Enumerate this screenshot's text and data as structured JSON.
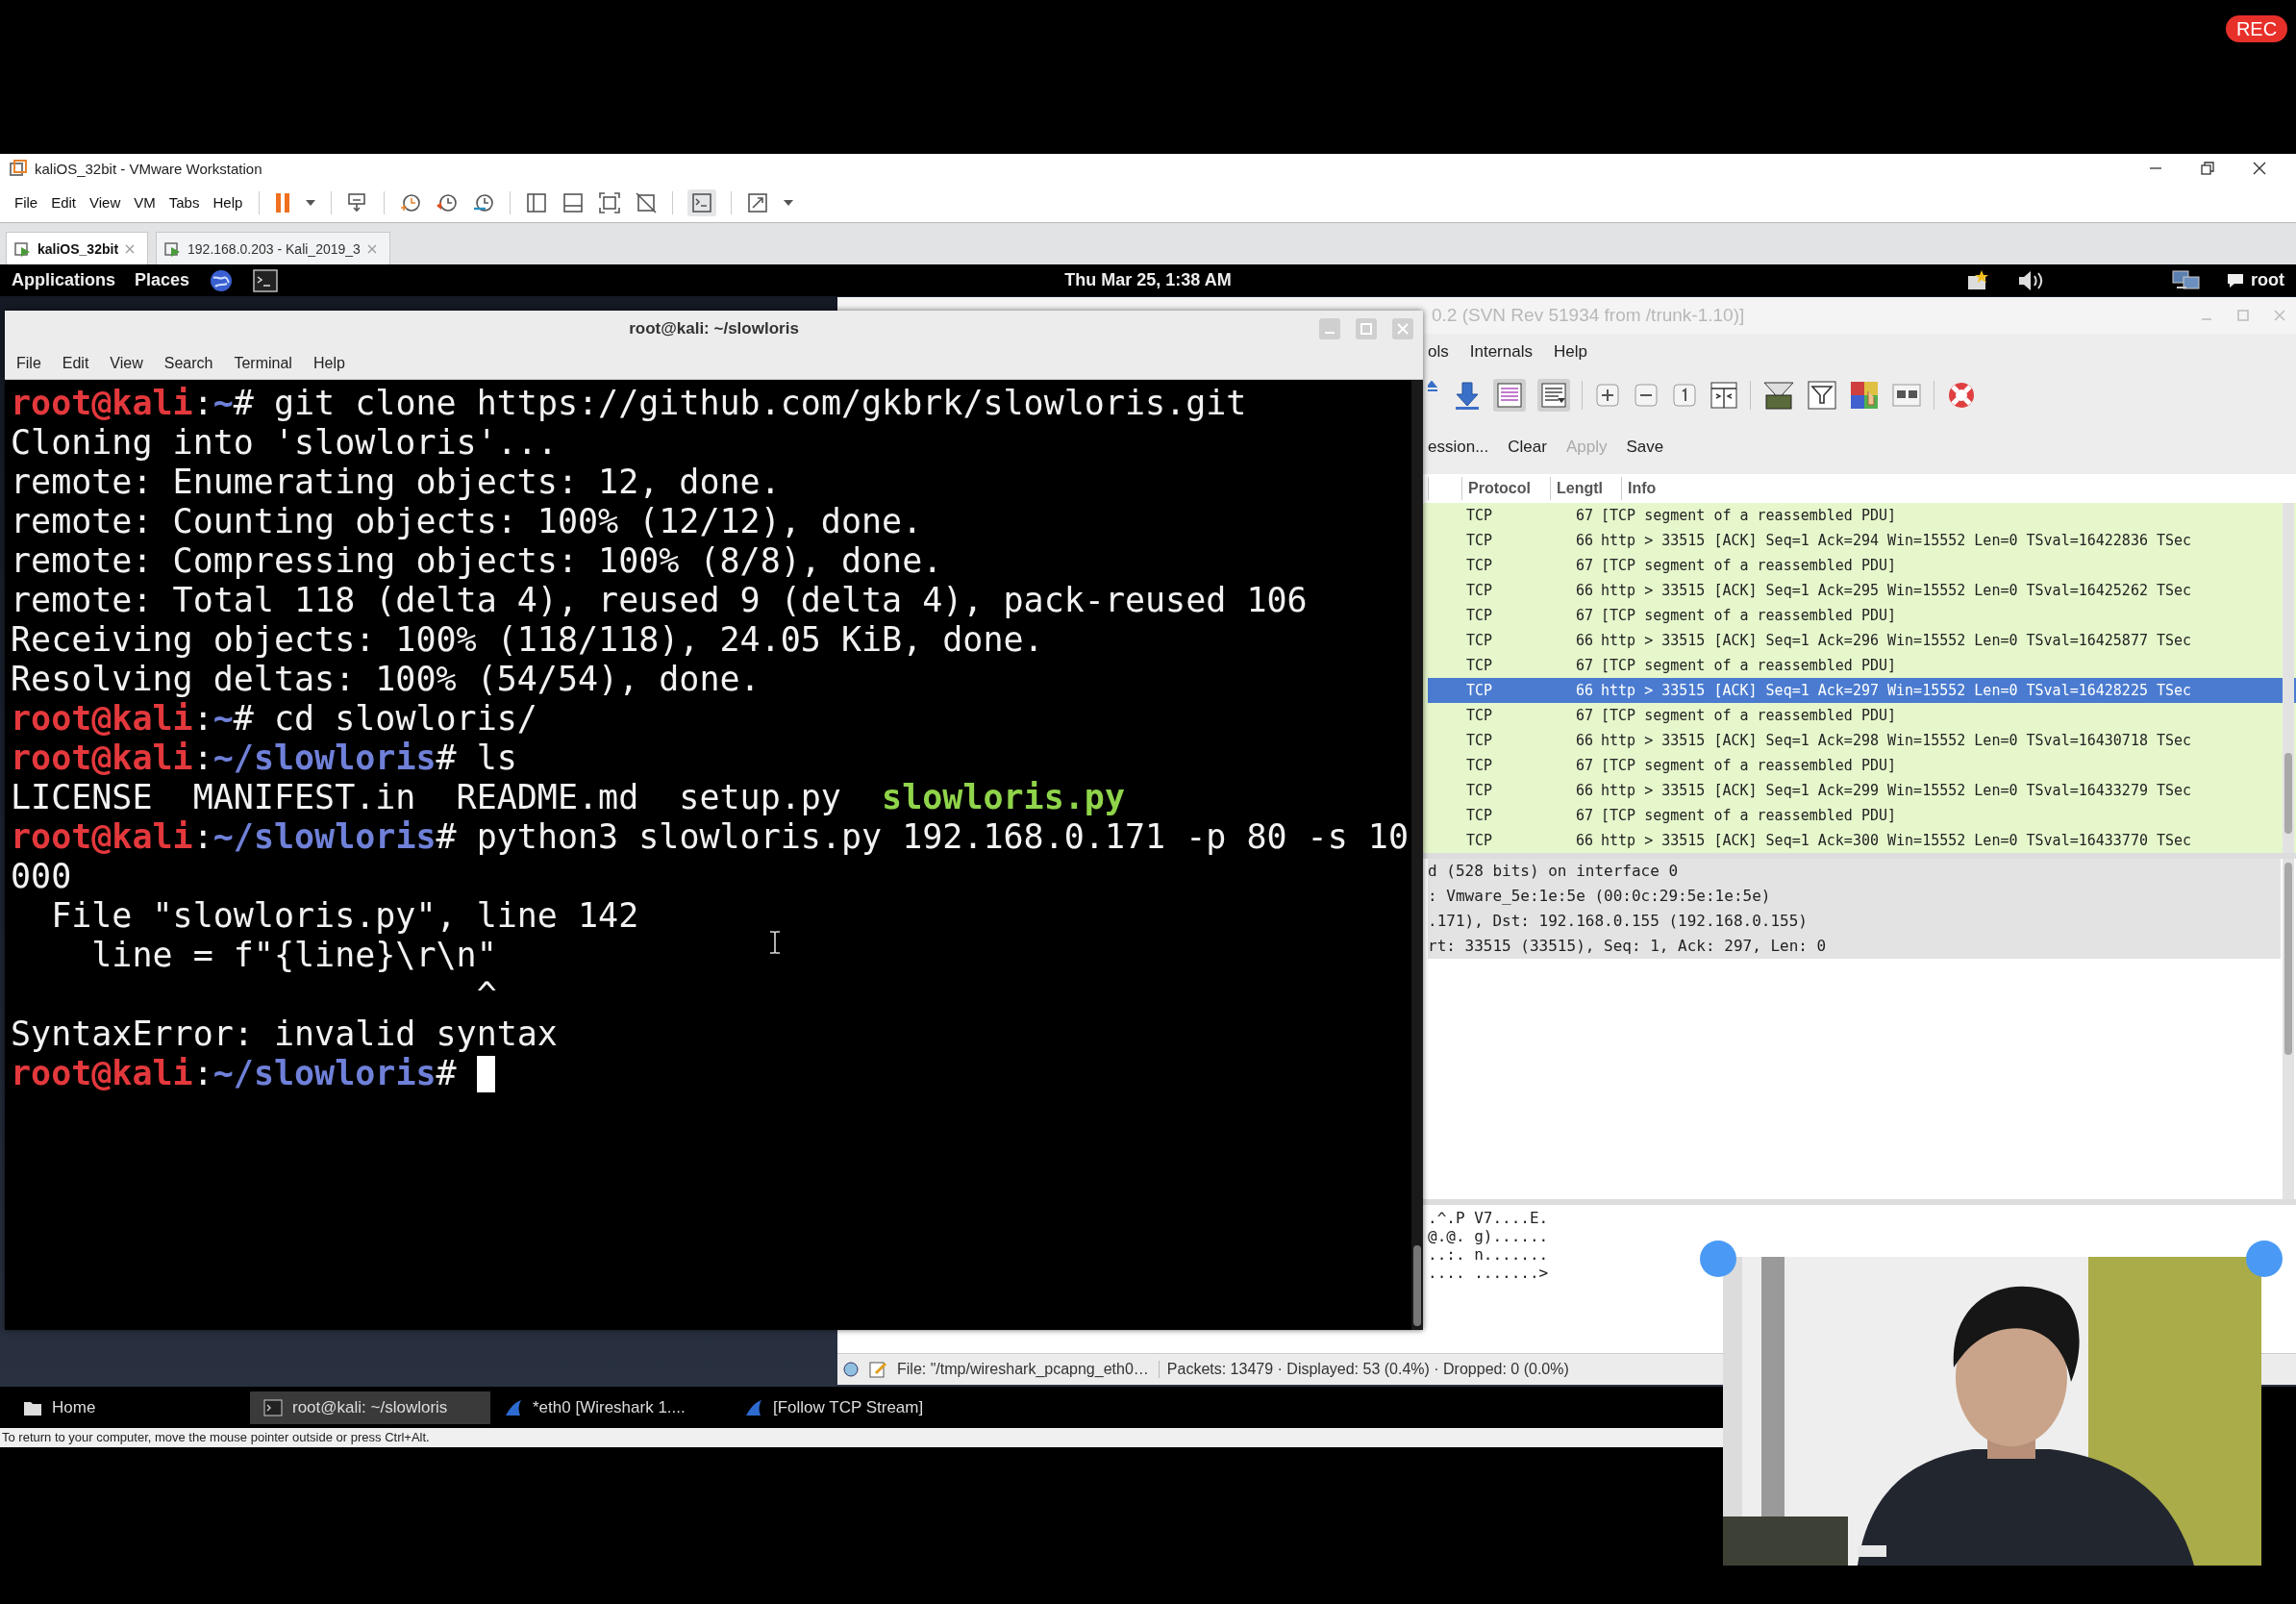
{
  "rec_badge": "REC",
  "vmware": {
    "title": "kaliOS_32bit - VMware Workstation",
    "menu": [
      "File",
      "Edit",
      "View",
      "VM",
      "Tabs",
      "Help"
    ],
    "tabs": [
      {
        "label": "kaliOS_32bit",
        "selected": true
      },
      {
        "label": "192.168.0.203 - Kali_2019_3",
        "selected": false
      }
    ],
    "status_hint": "To return to your computer, move the mouse pointer outside or press Ctrl+Alt."
  },
  "kali_panel": {
    "menus": [
      "Applications",
      "Places"
    ],
    "clock": "Thu Mar 25, 1:38 AM",
    "user": "root"
  },
  "terminal": {
    "title": "root@kali: ~/slowloris",
    "menu": [
      "File",
      "Edit",
      "View",
      "Search",
      "Terminal",
      "Help"
    ],
    "cursor": true,
    "lines": [
      {
        "kind": "text",
        "segments": [
          {
            "kind": "user",
            "text": "root@kali"
          },
          {
            "kind": "plain",
            "text": ":"
          },
          {
            "kind": "path",
            "text": "~"
          },
          {
            "kind": "plain",
            "text": "# git clone https://github.com/gkbrk/slowloris.git"
          }
        ]
      },
      {
        "kind": "text",
        "segments": [
          {
            "kind": "plain",
            "text": "Cloning into 'slowloris'..."
          }
        ]
      },
      {
        "kind": "text",
        "segments": [
          {
            "kind": "plain",
            "text": "remote: Enumerating objects: 12, done."
          }
        ]
      },
      {
        "kind": "text",
        "segments": [
          {
            "kind": "plain",
            "text": "remote: Counting objects: 100% (12/12), done."
          }
        ]
      },
      {
        "kind": "text",
        "segments": [
          {
            "kind": "plain",
            "text": "remote: Compressing objects: 100% (8/8), done."
          }
        ]
      },
      {
        "kind": "text",
        "segments": [
          {
            "kind": "plain",
            "text": "remote: Total 118 (delta 4), reused 9 (delta 4), pack-reused 106"
          }
        ]
      },
      {
        "kind": "text",
        "segments": [
          {
            "kind": "plain",
            "text": "Receiving objects: 100% (118/118), 24.05 KiB, done."
          }
        ]
      },
      {
        "kind": "text",
        "segments": [
          {
            "kind": "plain",
            "text": "Resolving deltas: 100% (54/54), done."
          }
        ]
      },
      {
        "kind": "text",
        "segments": [
          {
            "kind": "user",
            "text": "root@kali"
          },
          {
            "kind": "plain",
            "text": ":"
          },
          {
            "kind": "path",
            "text": "~"
          },
          {
            "kind": "plain",
            "text": "# cd slowloris/"
          }
        ]
      },
      {
        "kind": "text",
        "segments": [
          {
            "kind": "user",
            "text": "root@kali"
          },
          {
            "kind": "plain",
            "text": ":"
          },
          {
            "kind": "path",
            "text": "~/slowloris"
          },
          {
            "kind": "plain",
            "text": "# ls"
          }
        ]
      },
      {
        "kind": "text",
        "segments": [
          {
            "kind": "plain",
            "text": "LICENSE  MANIFEST.in  README.md  setup.py  "
          },
          {
            "kind": "exec",
            "text": "slowloris.py"
          }
        ]
      },
      {
        "kind": "text",
        "segments": [
          {
            "kind": "user",
            "text": "root@kali"
          },
          {
            "kind": "plain",
            "text": ":"
          },
          {
            "kind": "path",
            "text": "~/slowloris"
          },
          {
            "kind": "plain",
            "text": "# python3 slowloris.py 192.168.0.171 -p 80 -s 10"
          }
        ]
      },
      {
        "kind": "text",
        "segments": [
          {
            "kind": "plain",
            "text": "000"
          }
        ]
      },
      {
        "kind": "text",
        "segments": [
          {
            "kind": "plain",
            "text": "  File \"slowloris.py\", line 142"
          }
        ]
      },
      {
        "kind": "text",
        "segments": [
          {
            "kind": "plain",
            "text": "    line = f\"{line}\\r\\n\""
          }
        ]
      },
      {
        "kind": "text",
        "segments": [
          {
            "kind": "plain",
            "text": "                       ^"
          }
        ]
      },
      {
        "kind": "text",
        "segments": [
          {
            "kind": "plain",
            "text": "SyntaxError: invalid syntax"
          }
        ]
      },
      {
        "kind": "text",
        "segments": [
          {
            "kind": "user",
            "text": "root@kali"
          },
          {
            "kind": "plain",
            "text": ":"
          },
          {
            "kind": "path",
            "text": "~/slowloris"
          },
          {
            "kind": "plain",
            "text": "# "
          }
        ]
      }
    ]
  },
  "wireshark": {
    "title": "0.2  (SVN Rev 51934 from /trunk-1.10)]",
    "menu": [
      "ols",
      "Internals",
      "Help"
    ],
    "filter_actions": [
      {
        "label": "ession...",
        "disabled": false
      },
      {
        "label": "Clear",
        "disabled": false
      },
      {
        "label": "Apply",
        "disabled": true
      },
      {
        "label": "Save",
        "disabled": false
      }
    ],
    "columns": [
      "Protocol",
      "Lengtl",
      "Info"
    ],
    "packets": [
      {
        "protocol": "TCP",
        "length": "67",
        "info": "[TCP segment of a reassembled PDU]",
        "selected": false
      },
      {
        "protocol": "TCP",
        "length": "66",
        "info": "http > 33515 [ACK] Seq=1 Ack=294 Win=15552 Len=0 TSval=16422836 TSec",
        "selected": false
      },
      {
        "protocol": "TCP",
        "length": "67",
        "info": "[TCP segment of a reassembled PDU]",
        "selected": false
      },
      {
        "protocol": "TCP",
        "length": "66",
        "info": "http > 33515 [ACK] Seq=1 Ack=295 Win=15552 Len=0 TSval=16425262 TSec",
        "selected": false
      },
      {
        "protocol": "TCP",
        "length": "67",
        "info": "[TCP segment of a reassembled PDU]",
        "selected": false
      },
      {
        "protocol": "TCP",
        "length": "66",
        "info": "http > 33515 [ACK] Seq=1 Ack=296 Win=15552 Len=0 TSval=16425877 TSec",
        "selected": false
      },
      {
        "protocol": "TCP",
        "length": "67",
        "info": "[TCP segment of a reassembled PDU]",
        "selected": false
      },
      {
        "protocol": "TCP",
        "length": "66",
        "info": "http > 33515 [ACK] Seq=1 Ack=297 Win=15552 Len=0 TSval=16428225 TSec",
        "selected": true
      },
      {
        "protocol": "TCP",
        "length": "67",
        "info": "[TCP segment of a reassembled PDU]",
        "selected": false
      },
      {
        "protocol": "TCP",
        "length": "66",
        "info": "http > 33515 [ACK] Seq=1 Ack=298 Win=15552 Len=0 TSval=16430718 TSec",
        "selected": false
      },
      {
        "protocol": "TCP",
        "length": "67",
        "info": "[TCP segment of a reassembled PDU]",
        "selected": false
      },
      {
        "protocol": "TCP",
        "length": "66",
        "info": "http > 33515 [ACK] Seq=1 Ack=299 Win=15552 Len=0 TSval=16433279 TSec",
        "selected": false
      },
      {
        "protocol": "TCP",
        "length": "67",
        "info": "[TCP segment of a reassembled PDU]",
        "selected": false
      },
      {
        "protocol": "TCP",
        "length": "66",
        "info": "http > 33515 [ACK] Seq=1 Ack=300 Win=15552 Len=0 TSval=16433770 TSec",
        "selected": false
      }
    ],
    "details": [
      "d (528 bits) on interface 0",
      ": Vmware_5e:1e:5e (00:0c:29:5e:1e:5e)",
      ".171), Dst: 192.168.0.155 (192.168.0.155)",
      "rt: 33515 (33515), Seq: 1, Ack: 297, Len: 0"
    ],
    "bytes": [
      ".^.P V7....E.",
      "@.@. g)......",
      "..:. n.......",
      ".... .......>"
    ],
    "status": {
      "file": "File: \"/tmp/wireshark_pcapng_eth0…",
      "counts": "Packets: 13479 · Displayed: 53 (0.4%) · Dropped: 0 (0.0%)"
    }
  },
  "taskbar": [
    {
      "kind": "folder",
      "label": "Home",
      "selected": false
    },
    {
      "kind": "terminal",
      "label": "root@kali: ~/slowloris",
      "selected": true
    },
    {
      "kind": "wireshark",
      "label": "*eth0   [Wireshark 1....",
      "selected": false
    },
    {
      "kind": "wireshark",
      "label": "[Follow TCP Stream]",
      "selected": false
    }
  ]
}
